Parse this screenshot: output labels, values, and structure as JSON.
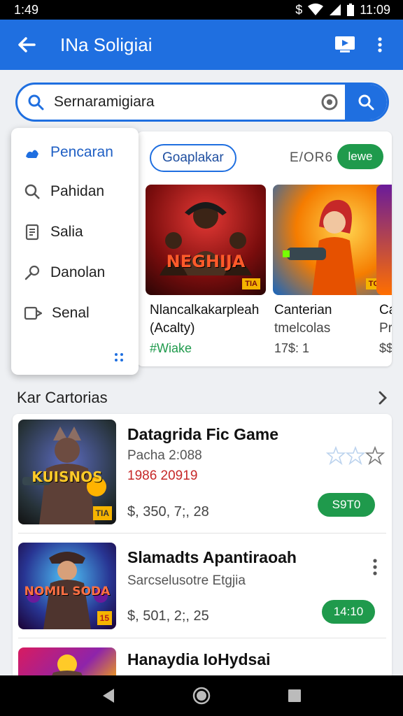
{
  "status": {
    "time": "1:49",
    "right_time": "11:09"
  },
  "app_bar": {
    "title": "INa Soligiai"
  },
  "search": {
    "query": "Sernaramigiara"
  },
  "dropdown": {
    "items": [
      {
        "label": "Pencaran",
        "icon": "spark-icon"
      },
      {
        "label": "Pahidan",
        "icon": "search-icon"
      },
      {
        "label": "Salia",
        "icon": "document-icon"
      },
      {
        "label": "Danolan",
        "icon": "pin-icon"
      },
      {
        "label": "Senal",
        "icon": "share-icon"
      }
    ]
  },
  "featured": {
    "chip_label": "Goaplakar",
    "side_label": "E/OR6",
    "pill_label": "lewe",
    "tiles": [
      {
        "art_text": "NEGHIJA",
        "badge": "TIA",
        "title_line1": "Nlancalkakarpleah",
        "title_line2": "(Acalty)",
        "meta": "#Wiake"
      },
      {
        "art_text": "",
        "badge": "TGA",
        "title_line1": "Canterian",
        "title_line2": "tmelcolas",
        "meta": "17$: 1"
      },
      {
        "art_text": "",
        "badge": "",
        "title_line1": "Ca",
        "title_line2": "Pr",
        "meta": "$$"
      }
    ]
  },
  "section": {
    "title": "Kar Cartorias"
  },
  "list": [
    {
      "title": "Datagrida Fic Game",
      "subtitle": "Pacha 2:088",
      "red_line": "1986 20919",
      "price": "$, 350, 7;, 28",
      "button": "S9T0",
      "art_text": "KUISNOS",
      "badge": "TIA"
    },
    {
      "title": "Slamadts Apantiraoah",
      "subtitle": "Sarcselusotre Etgjia",
      "red_line": "",
      "price": "$, 501, 2;, 25",
      "button": "14:10",
      "art_text": "NOMIL SODA",
      "badge": "15"
    },
    {
      "title": "Hanaydia IoHydsai",
      "subtitle": "",
      "red_line": "",
      "price": "",
      "button": "",
      "art_text": "",
      "badge": ""
    }
  ],
  "colors": {
    "primary": "#1f6fe0",
    "green": "#1f9a4c",
    "red": "#c62828"
  }
}
